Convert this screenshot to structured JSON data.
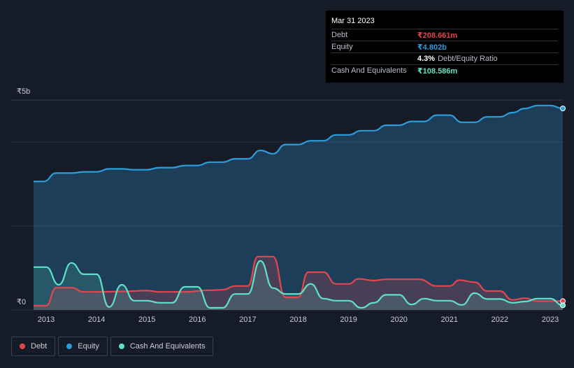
{
  "tooltip": {
    "date": "Mar 31 2023",
    "debt_label": "Debt",
    "debt_value": "₹208.661m",
    "equity_label": "Equity",
    "equity_value": "₹4.802b",
    "ratio_value": "4.3%",
    "ratio_label": "Debt/Equity Ratio",
    "cash_label": "Cash And Equivalents",
    "cash_value": "₹108.586m"
  },
  "legend": {
    "debt": "Debt",
    "equity": "Equity",
    "cash": "Cash And Equivalents"
  },
  "colors": {
    "debt": "#e2464f",
    "equity": "#2d9cdb",
    "cash": "#5fe3c8",
    "background": "#151b27"
  },
  "chart_data": {
    "type": "area",
    "y_unit": "₹ billions",
    "ylim": [
      0,
      5
    ],
    "y_tick_labels": [
      "₹0",
      "₹5b"
    ],
    "x_tick_labels": [
      "2013",
      "2014",
      "2015",
      "2016",
      "2017",
      "2018",
      "2019",
      "2020",
      "2021",
      "2022",
      "2023"
    ],
    "grid": true,
    "legend_position": "bottom-left",
    "series": [
      {
        "name": "Equity",
        "points": [
          [
            2012.75,
            3.06
          ],
          [
            2012.95,
            3.06
          ],
          [
            2013.2,
            3.26
          ],
          [
            2013.5,
            3.26
          ],
          [
            2013.75,
            3.29
          ],
          [
            2014.0,
            3.29
          ],
          [
            2014.25,
            3.36
          ],
          [
            2014.5,
            3.36
          ],
          [
            2014.75,
            3.34
          ],
          [
            2015.0,
            3.34
          ],
          [
            2015.25,
            3.39
          ],
          [
            2015.5,
            3.39
          ],
          [
            2015.75,
            3.44
          ],
          [
            2016.0,
            3.44
          ],
          [
            2016.25,
            3.52
          ],
          [
            2016.5,
            3.52
          ],
          [
            2016.75,
            3.6
          ],
          [
            2017.0,
            3.6
          ],
          [
            2017.25,
            3.8
          ],
          [
            2017.5,
            3.72
          ],
          [
            2017.75,
            3.94
          ],
          [
            2018.0,
            3.94
          ],
          [
            2018.25,
            4.03
          ],
          [
            2018.5,
            4.03
          ],
          [
            2018.75,
            4.17
          ],
          [
            2019.0,
            4.17
          ],
          [
            2019.25,
            4.27
          ],
          [
            2019.5,
            4.27
          ],
          [
            2019.75,
            4.4
          ],
          [
            2020.0,
            4.4
          ],
          [
            2020.25,
            4.49
          ],
          [
            2020.5,
            4.49
          ],
          [
            2020.75,
            4.64
          ],
          [
            2021.0,
            4.64
          ],
          [
            2021.25,
            4.47
          ],
          [
            2021.5,
            4.47
          ],
          [
            2021.75,
            4.6
          ],
          [
            2022.0,
            4.6
          ],
          [
            2022.25,
            4.7
          ],
          [
            2022.5,
            4.8
          ],
          [
            2022.75,
            4.87
          ],
          [
            2023.0,
            4.87
          ],
          [
            2023.25,
            4.8
          ]
        ]
      },
      {
        "name": "Debt",
        "points": [
          [
            2012.75,
            0.1
          ],
          [
            2013.0,
            0.1
          ],
          [
            2013.2,
            0.53
          ],
          [
            2013.5,
            0.53
          ],
          [
            2013.75,
            0.43
          ],
          [
            2014.0,
            0.43
          ],
          [
            2014.5,
            0.44
          ],
          [
            2015.0,
            0.46
          ],
          [
            2015.25,
            0.43
          ],
          [
            2015.75,
            0.43
          ],
          [
            2016.25,
            0.47
          ],
          [
            2016.5,
            0.48
          ],
          [
            2016.75,
            0.57
          ],
          [
            2017.0,
            0.57
          ],
          [
            2017.2,
            1.27
          ],
          [
            2017.5,
            1.27
          ],
          [
            2017.75,
            0.3
          ],
          [
            2018.0,
            0.3
          ],
          [
            2018.2,
            0.9
          ],
          [
            2018.5,
            0.9
          ],
          [
            2018.75,
            0.62
          ],
          [
            2019.0,
            0.62
          ],
          [
            2019.2,
            0.74
          ],
          [
            2019.5,
            0.7
          ],
          [
            2019.75,
            0.73
          ],
          [
            2020.0,
            0.73
          ],
          [
            2020.4,
            0.73
          ],
          [
            2020.75,
            0.57
          ],
          [
            2021.0,
            0.57
          ],
          [
            2021.2,
            0.71
          ],
          [
            2021.5,
            0.66
          ],
          [
            2021.75,
            0.45
          ],
          [
            2022.0,
            0.45
          ],
          [
            2022.25,
            0.24
          ],
          [
            2022.5,
            0.28
          ],
          [
            2022.75,
            0.21
          ],
          [
            2023.0,
            0.21
          ],
          [
            2023.25,
            0.21
          ]
        ]
      },
      {
        "name": "Cash And Equivalents",
        "points": [
          [
            2012.75,
            1.02
          ],
          [
            2013.0,
            1.02
          ],
          [
            2013.25,
            0.6
          ],
          [
            2013.5,
            1.12
          ],
          [
            2013.75,
            0.85
          ],
          [
            2014.0,
            0.85
          ],
          [
            2014.25,
            0.07
          ],
          [
            2014.5,
            0.6
          ],
          [
            2014.75,
            0.22
          ],
          [
            2015.0,
            0.22
          ],
          [
            2015.25,
            0.17
          ],
          [
            2015.5,
            0.17
          ],
          [
            2015.75,
            0.55
          ],
          [
            2016.0,
            0.55
          ],
          [
            2016.25,
            0.05
          ],
          [
            2016.5,
            0.05
          ],
          [
            2016.75,
            0.38
          ],
          [
            2017.0,
            0.38
          ],
          [
            2017.25,
            1.17
          ],
          [
            2017.5,
            0.52
          ],
          [
            2017.75,
            0.38
          ],
          [
            2018.0,
            0.38
          ],
          [
            2018.25,
            0.62
          ],
          [
            2018.5,
            0.27
          ],
          [
            2018.75,
            0.22
          ],
          [
            2019.0,
            0.22
          ],
          [
            2019.25,
            0.05
          ],
          [
            2019.5,
            0.17
          ],
          [
            2019.75,
            0.36
          ],
          [
            2020.0,
            0.36
          ],
          [
            2020.25,
            0.13
          ],
          [
            2020.5,
            0.27
          ],
          [
            2020.75,
            0.22
          ],
          [
            2021.0,
            0.22
          ],
          [
            2021.25,
            0.12
          ],
          [
            2021.5,
            0.4
          ],
          [
            2021.75,
            0.26
          ],
          [
            2022.0,
            0.26
          ],
          [
            2022.25,
            0.17
          ],
          [
            2022.5,
            0.2
          ],
          [
            2022.75,
            0.27
          ],
          [
            2023.0,
            0.27
          ],
          [
            2023.25,
            0.11
          ]
        ]
      }
    ]
  }
}
